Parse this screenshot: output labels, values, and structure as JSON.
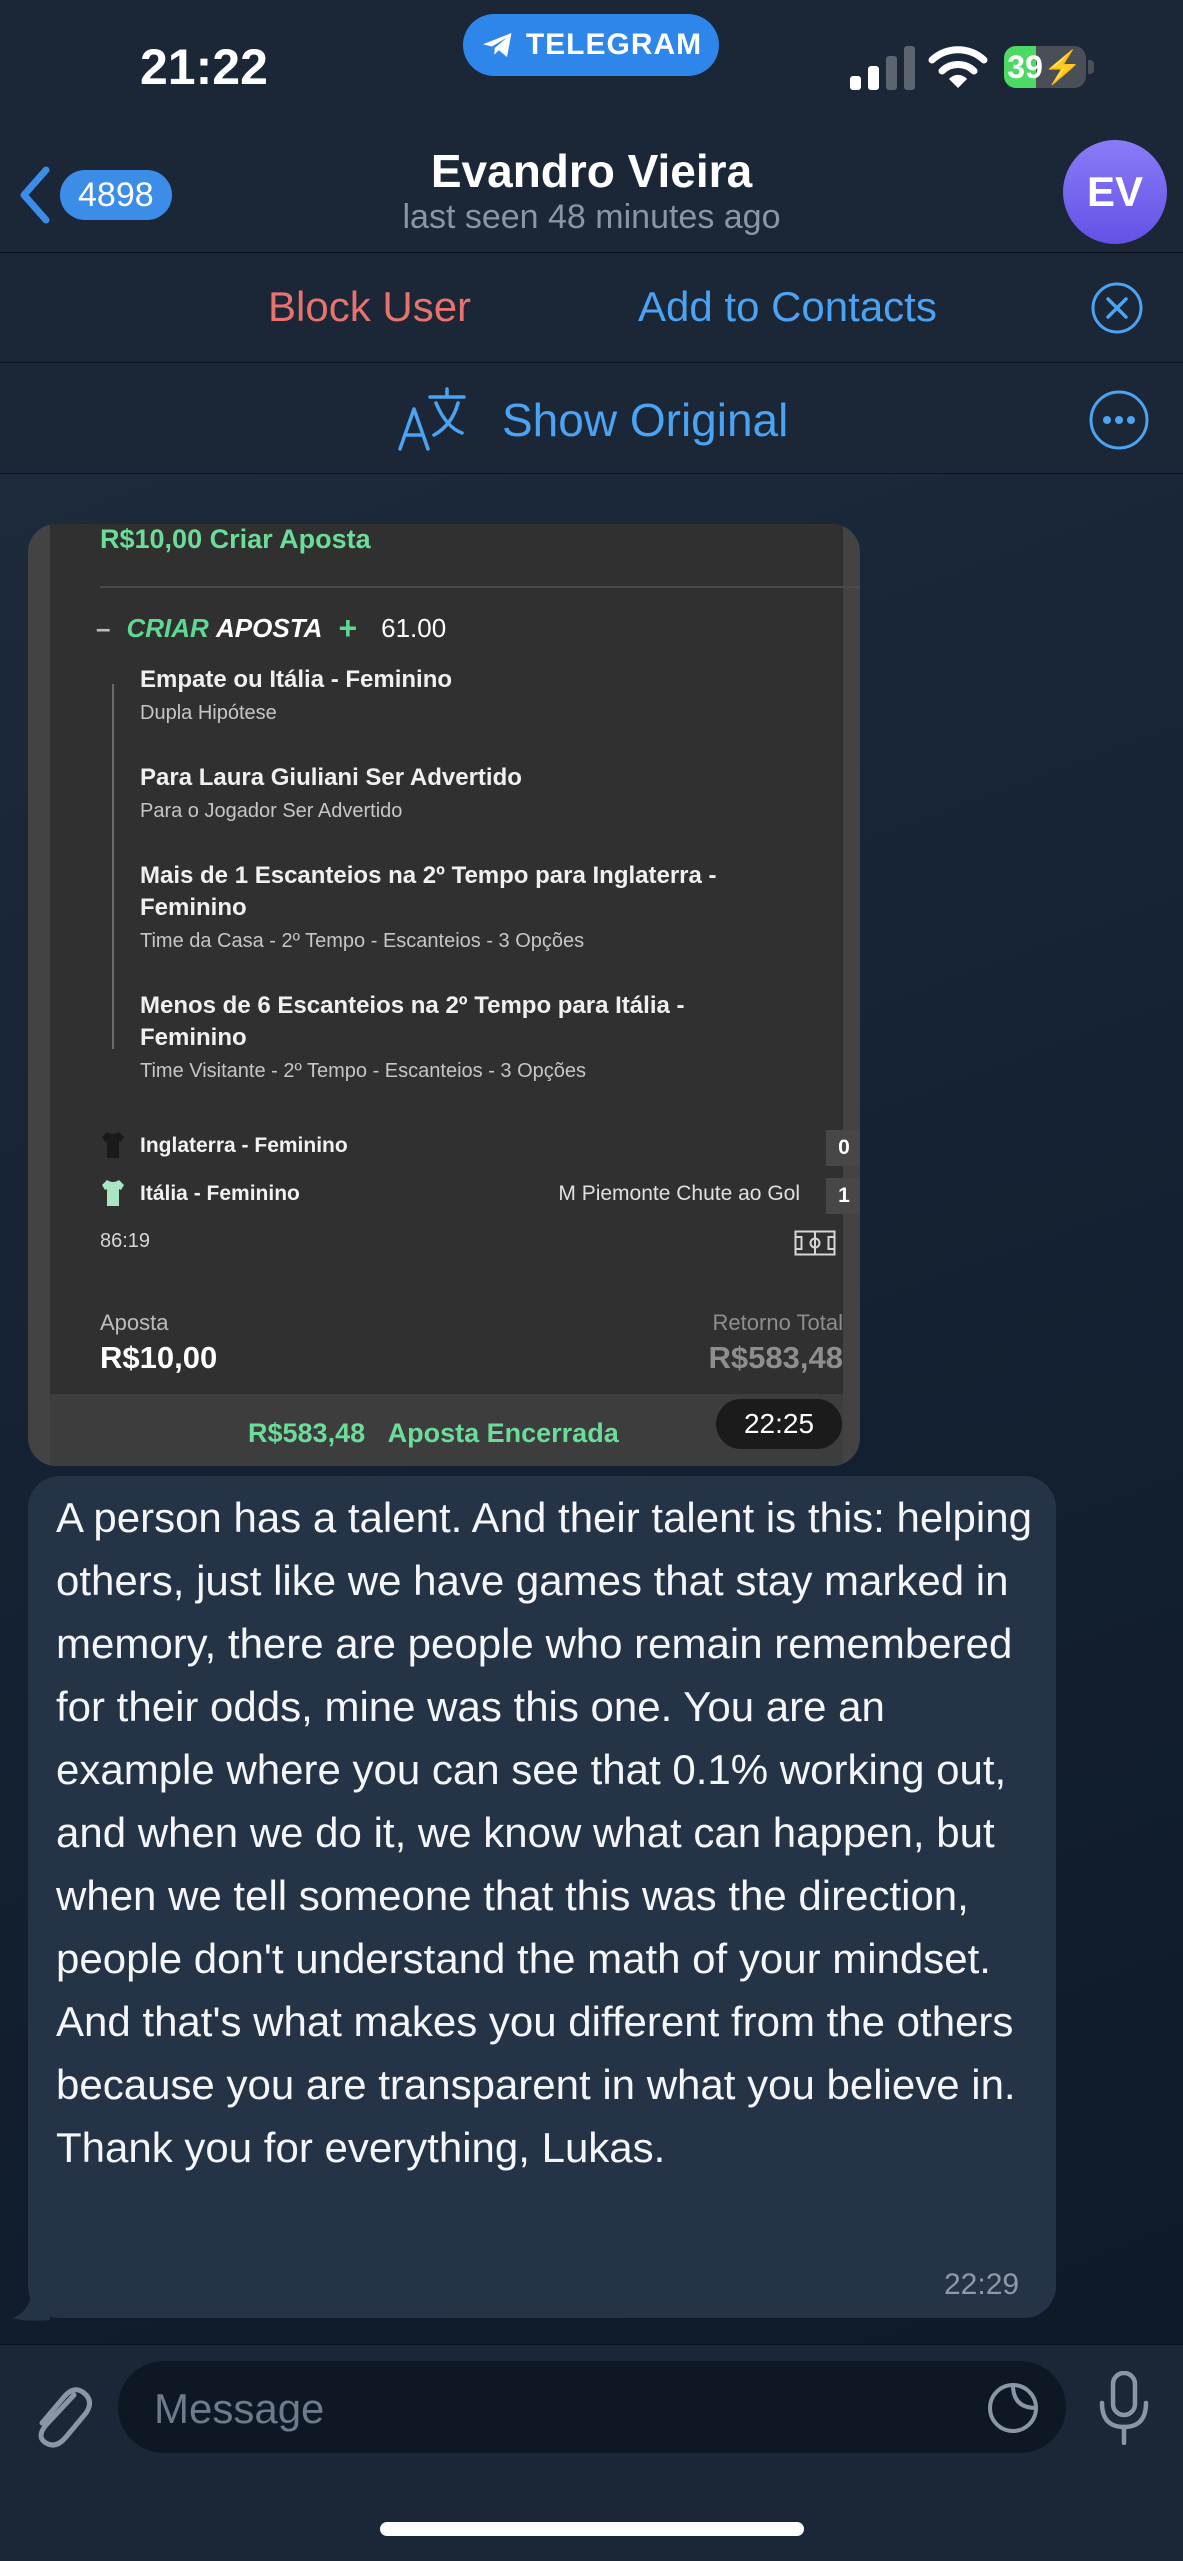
{
  "status_bar": {
    "time": "21:22",
    "app_pill": "TELEGRAM",
    "battery": "39",
    "battery_level": 0.39
  },
  "header": {
    "back_badge": "4898",
    "name": "Evandro Vieira",
    "last_seen": "last seen 48 minutes ago",
    "avatar_initials": "EV"
  },
  "actions": {
    "block": "Block User",
    "add_contact": "Add to Contacts"
  },
  "translate": {
    "show_original": "Show Original"
  },
  "bet_card": {
    "stake_title": "R$10,00 Criar Aposta",
    "dash": "–",
    "criar_a": "CRIAR ",
    "criar_b": "APOSTA",
    "plus": "+",
    "odds": "61.00",
    "selections": [
      {
        "title": "Empate ou Itália - Feminino",
        "subtitle": "Dupla Hipótese"
      },
      {
        "title": "Para Laura Giuliani Ser Advertido",
        "subtitle": "Para o Jogador Ser Advertido"
      },
      {
        "title": "Mais de 1 Escanteios na 2º Tempo para Inglaterra - Feminino",
        "subtitle": "Time da Casa - 2º Tempo - Escanteios - 3 Opções"
      },
      {
        "title": "Menos de 6 Escanteios na 2º Tempo para Itália - Feminino",
        "subtitle": "Time Visitante - 2º Tempo - Escanteios - 3 Opções"
      }
    ],
    "teams": [
      {
        "name": "Inglaterra - Feminino",
        "event": "",
        "score": "0",
        "shirt_color": "#1a1a1a"
      },
      {
        "name": "Itália - Feminino",
        "event": "M Piemonte Chute ao Gol",
        "score": "1",
        "shirt_color": "#a8e6c6"
      }
    ],
    "match_clock": "86:19",
    "stake_label": "Aposta",
    "stake_value": "R$10,00",
    "return_label": "Retorno Total",
    "return_value": "R$583,48",
    "closed_amount": "R$583,48",
    "closed_label": "Aposta Encerrada",
    "timestamp": "22:25"
  },
  "message": {
    "text": "A person has a talent. And their talent is this: helping others, just like we have games that stay marked in memory, there are people who remain remembered for their odds, mine was this one. You are an example where you can see that 0.1% working out, and when we do it, we know what can happen, but when we tell someone that this was the direction, people don't understand the math of your mindset. And that's what makes you different from the others because you are transparent in what you believe in. Thank you for everything, Lukas.",
    "time": "22:29"
  },
  "input": {
    "placeholder": "Message"
  },
  "colors": {
    "accent": "#4ba3f3",
    "danger": "#e8736e",
    "bet_green": "#6cdc9a",
    "bubble": "#253346"
  }
}
